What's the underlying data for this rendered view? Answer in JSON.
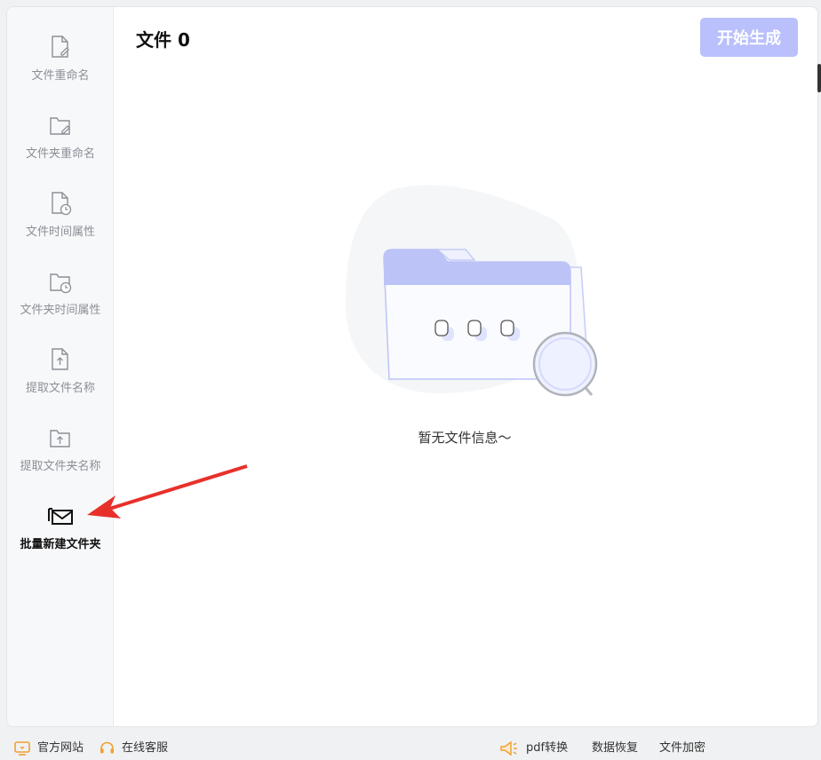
{
  "sidebar": {
    "items": [
      {
        "label": "文件重命名",
        "icon": "file-edit-icon"
      },
      {
        "label": "文件夹重命名",
        "icon": "folder-edit-icon"
      },
      {
        "label": "文件时间属性",
        "icon": "file-clock-icon"
      },
      {
        "label": "文件夹时间属性",
        "icon": "folder-clock-icon"
      },
      {
        "label": "提取文件名称",
        "icon": "file-upload-icon"
      },
      {
        "label": "提取文件夹名称",
        "icon": "folder-upload-icon"
      },
      {
        "label": "批量新建文件夹",
        "icon": "mail-folder-icon",
        "active": true
      }
    ]
  },
  "main": {
    "title": "文件 0",
    "generate_button": "开始生成",
    "empty_text": "暂无文件信息～"
  },
  "footer": {
    "website": "官方网站",
    "support": "在线客服",
    "pdf": "pdf转换",
    "recovery": "数据恢复",
    "encrypt": "文件加密"
  },
  "colors": {
    "accent": "#b9c0fb",
    "arrow": "#e8302a"
  }
}
